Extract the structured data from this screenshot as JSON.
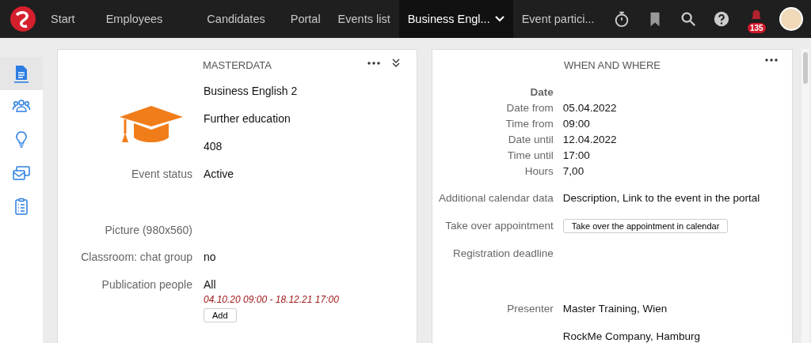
{
  "topbar": {
    "tabs": [
      {
        "label": "Start",
        "selected": false
      },
      {
        "label": "Employees",
        "selected": false
      },
      {
        "label": "Candidates",
        "selected": false
      },
      {
        "label": "Portal",
        "selected": false
      },
      {
        "label": "Events list",
        "selected": false
      },
      {
        "label": "Business Engl...",
        "selected": true
      },
      {
        "label": "Event partici...",
        "selected": false
      }
    ],
    "notification_count": "135"
  },
  "sidebar": {
    "items": [
      {
        "selected": true
      },
      {
        "selected": false
      },
      {
        "selected": false
      },
      {
        "selected": false
      },
      {
        "selected": false
      }
    ]
  },
  "masterdata": {
    "title": "MASTERDATA",
    "header_lines": [
      "Business English 2",
      "Further education",
      "408"
    ],
    "rows": [
      {
        "kind": "field",
        "label": "Event status",
        "value": "Active"
      },
      {
        "kind": "image",
        "label": "Picture (980x560)"
      },
      {
        "kind": "field",
        "label": "Classroom: chat group",
        "value": "no"
      },
      {
        "kind": "publication",
        "label": "Publication people",
        "value": "All",
        "period": "04.10.20 09:00 - 18.12.21 17:00",
        "button": "Add"
      }
    ]
  },
  "when_and_where": {
    "title": "WHEN AND WHERE",
    "rows": [
      {
        "kind": "heading",
        "label": "Date"
      },
      {
        "kind": "compact",
        "label": "Date from",
        "value": "05.04.2022"
      },
      {
        "kind": "compact",
        "label": "Time from",
        "value": "09:00"
      },
      {
        "kind": "compact",
        "label": "Date until",
        "value": "12.04.2022"
      },
      {
        "kind": "compact",
        "label": "Time until",
        "value": "17:00"
      },
      {
        "kind": "compact",
        "label": "Hours",
        "value": "7,00"
      },
      {
        "kind": "field",
        "label": "Additional calendar data",
        "value": "Description, Link to the event in the portal"
      },
      {
        "kind": "button",
        "label": "Take over appointment",
        "button": "Take over the appointment in calendar"
      },
      {
        "kind": "date",
        "label": "Registration deadline"
      },
      {
        "kind": "field",
        "label": "Presenter",
        "value": "Master Training, Wien"
      },
      {
        "kind": "field",
        "value": "RockMe Company, Hamburg"
      }
    ]
  }
}
